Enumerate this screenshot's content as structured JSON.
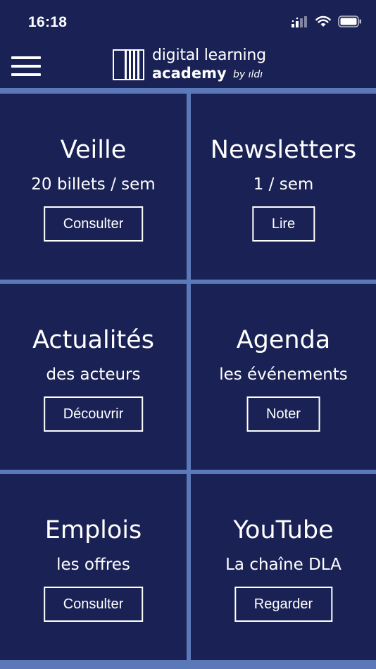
{
  "status_bar": {
    "time": "16:18"
  },
  "header": {
    "logo": {
      "line1": "digital learning",
      "line2": "academy",
      "by": "by ıldı"
    }
  },
  "colors": {
    "background": "#1a2255",
    "divider": "#5b78b8",
    "text": "#ffffff"
  },
  "tiles": [
    {
      "title": "Veille",
      "subtitle": "20 billets / sem",
      "button": "Consulter"
    },
    {
      "title": "Newsletters",
      "subtitle": "1 / sem",
      "button": "Lire"
    },
    {
      "title": "Actualités",
      "subtitle": "des acteurs",
      "button": "Découvrir"
    },
    {
      "title": "Agenda",
      "subtitle": "les événements",
      "button": "Noter"
    },
    {
      "title": "Emplois",
      "subtitle": "les offres",
      "button": "Consulter"
    },
    {
      "title": "YouTube",
      "subtitle": "La chaîne DLA",
      "button": "Regarder"
    }
  ]
}
